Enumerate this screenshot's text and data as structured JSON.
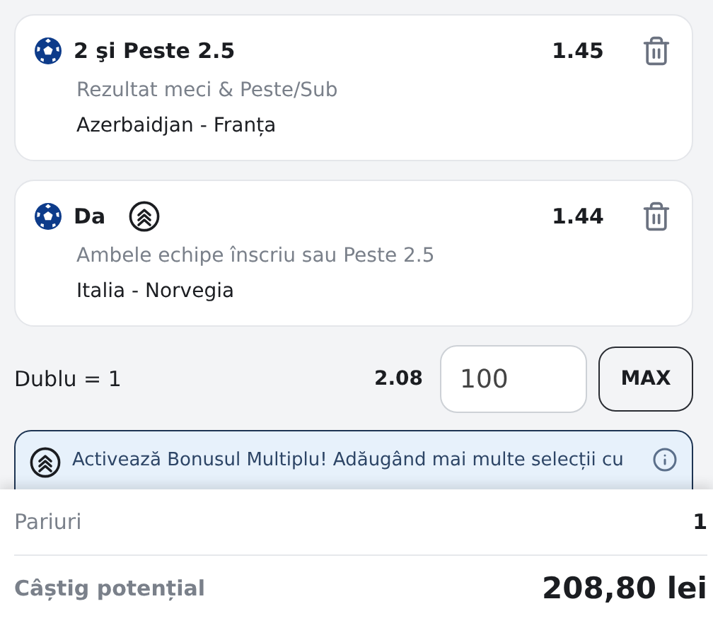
{
  "selections": [
    {
      "pick": "2 şi Peste 2.5",
      "boost": false,
      "odds": "1.45",
      "market": "Rezultat meci & Peste/Sub",
      "event": "Azerbaidjan - Franța"
    },
    {
      "pick": "Da",
      "boost": true,
      "odds": "1.44",
      "market": "Ambele echipe înscriu sau Peste 2.5",
      "event": "Italia - Norvegia"
    }
  ],
  "combo": {
    "label": "Dublu = 1",
    "odds": "2.08",
    "stake": "100",
    "max_button": "MAX"
  },
  "banner": {
    "text": "Activează Bonusul Multiplu! Adăugând mai multe selecții cu"
  },
  "summary": {
    "bets_label": "Pariuri",
    "bets": "1",
    "win_label": "Câștig potențial",
    "win": "208,80 lei"
  }
}
